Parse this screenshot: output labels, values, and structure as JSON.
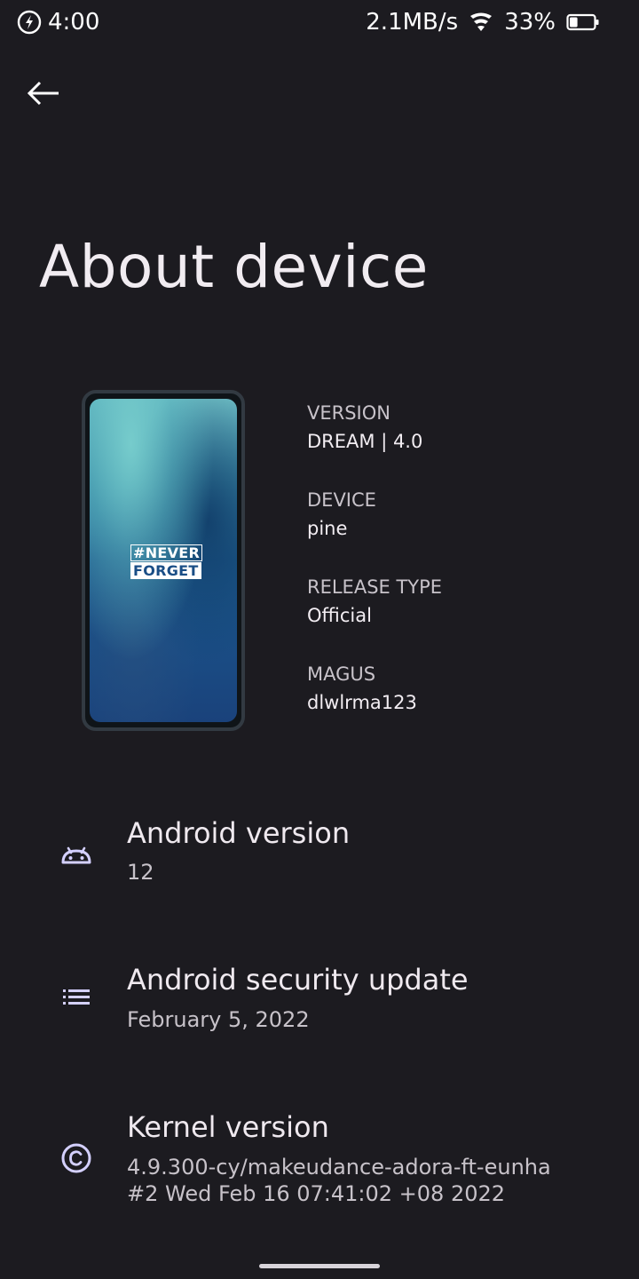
{
  "status_bar": {
    "time": "4:00",
    "network_speed": "2.1MB/s",
    "battery_percent": "33%",
    "battery_level": 0.33,
    "icons": [
      "data-saver-icon",
      "wifi-icon",
      "battery-icon"
    ]
  },
  "header": {
    "back_icon": "arrow-left-icon",
    "title": "About device"
  },
  "device_image": {
    "wallpaper_text": [
      "#NEVER",
      "FORGET"
    ]
  },
  "device_info": [
    {
      "label": "VERSION",
      "value": "DREAM | 4.0"
    },
    {
      "label": "DEVICE",
      "value": "pine"
    },
    {
      "label": "RELEASE TYPE",
      "value": "Official"
    },
    {
      "label": "MAGUS",
      "value": "dlwlrma123"
    }
  ],
  "preferences": [
    {
      "icon": "android-icon",
      "title": "Android version",
      "summary": [
        "12"
      ]
    },
    {
      "icon": "list-icon",
      "title": "Android security update",
      "summary": [
        "February 5, 2022"
      ]
    },
    {
      "icon": "copyright-icon",
      "title": "Kernel version",
      "summary": [
        "4.9.300-cy/makeudance-adora-ft-eunha",
        "#2 Wed Feb 16 07:41:02 +08 2022"
      ]
    }
  ],
  "colors": {
    "background": "#1c1b20",
    "text_primary": "#efe9ef",
    "text_secondary": "#c7c2c9",
    "icon_tint": "#d4d0ff"
  }
}
